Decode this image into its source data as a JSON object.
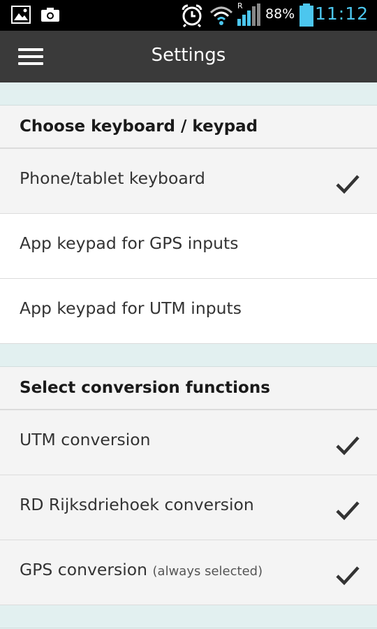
{
  "status_bar": {
    "battery_percent": "88%",
    "signal_label": "R",
    "time": "11:12",
    "icons": [
      "image-icon",
      "camera-icon",
      "alarm-icon",
      "wifi-icon",
      "signal-icon",
      "battery-icon"
    ],
    "colors": {
      "clock": "#4cc6ee",
      "battery": "#4cc6ee"
    }
  },
  "app_bar": {
    "title": "Settings",
    "menu_icon": "hamburger-menu-icon",
    "background": "#3a3a3a"
  },
  "sections": [
    {
      "header": "Choose keyboard / keypad",
      "items": [
        {
          "label": "Phone/tablet keyboard",
          "checked": true
        },
        {
          "label": "App keypad for GPS inputs",
          "checked": false
        },
        {
          "label": "App keypad for UTM inputs",
          "checked": false
        }
      ]
    },
    {
      "header": "Select conversion functions",
      "items": [
        {
          "label": "UTM conversion",
          "checked": true
        },
        {
          "label": "RD Rijksdriehoek conversion",
          "checked": true
        },
        {
          "label": "GPS conversion",
          "hint": "(always selected)",
          "checked": true
        }
      ]
    }
  ]
}
